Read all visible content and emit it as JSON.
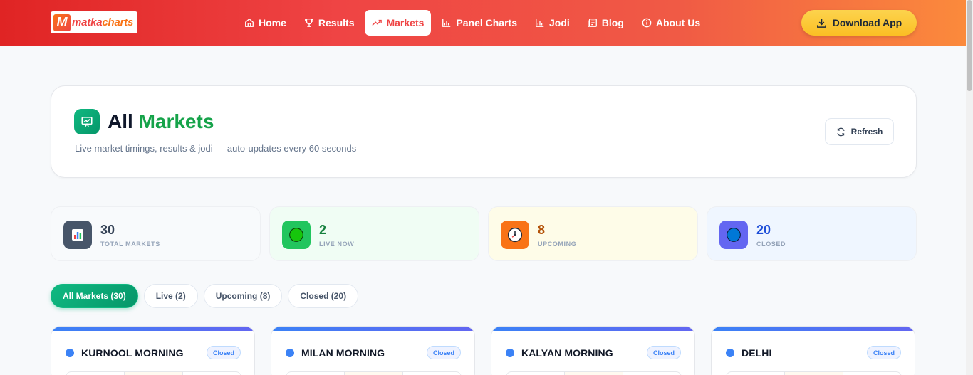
{
  "nav": {
    "logo_text_a": "matka",
    "logo_text_b": "charts",
    "logo_mark": "M",
    "items": [
      {
        "label": "Home",
        "icon": "home-icon"
      },
      {
        "label": "Results",
        "icon": "trophy-icon"
      },
      {
        "label": "Markets",
        "icon": "trending-up-icon",
        "active": true
      },
      {
        "label": "Panel Charts",
        "icon": "bar-chart-icon"
      },
      {
        "label": "Jodi",
        "icon": "bar-chart-icon"
      },
      {
        "label": "Blog",
        "icon": "newspaper-icon"
      },
      {
        "label": "About Us",
        "icon": "info-icon"
      }
    ],
    "download_label": "Download App"
  },
  "header": {
    "title_a": "All",
    "title_b": "Markets",
    "subtitle": "Live market timings, results & jodi — auto-updates every 60 seconds",
    "refresh_label": "Refresh"
  },
  "stats": [
    {
      "value": "30",
      "label": "TOTAL MARKETS",
      "icon": "chart-icon",
      "color": "#475569"
    },
    {
      "value": "2",
      "label": "LIVE NOW",
      "icon": "green-circle-icon",
      "color": "#15803d"
    },
    {
      "value": "8",
      "label": "UPCOMING",
      "icon": "clock-icon",
      "color": "#b45309"
    },
    {
      "value": "20",
      "label": "CLOSED",
      "icon": "blue-circle-icon",
      "color": "#1d4ed8"
    }
  ],
  "tabs": [
    {
      "label": "All Markets (30)",
      "active": true
    },
    {
      "label": "Live (2)"
    },
    {
      "label": "Upcoming (8)"
    },
    {
      "label": "Closed (20)"
    }
  ],
  "markets": [
    {
      "name": "KURNOOL MORNING",
      "status": "Closed"
    },
    {
      "name": "MILAN MORNING",
      "status": "Closed"
    },
    {
      "name": "KALYAN MORNING",
      "status": "Closed"
    },
    {
      "name": "DELHI",
      "status": "Closed"
    }
  ],
  "colors": {
    "accent_green": "#10b981",
    "nav_red": "#ef4444",
    "nav_orange": "#fb8a3c",
    "download_yellow": "#fbbf24"
  }
}
